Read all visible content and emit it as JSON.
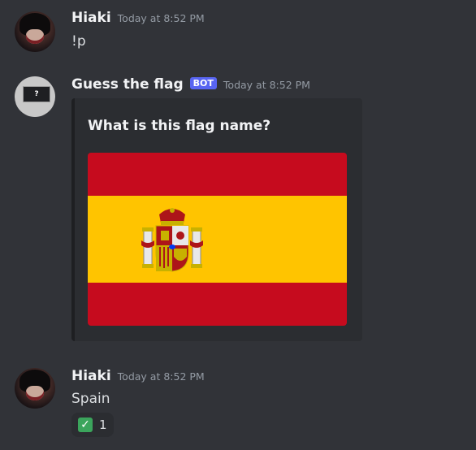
{
  "messages": [
    {
      "username": "Hiaki",
      "timestamp": "Today at 8:52 PM",
      "content": "!p"
    },
    {
      "username": "Guess the flag",
      "badge": "BOT",
      "timestamp": "Today at 8:52 PM",
      "avatar_text": "?",
      "embed": {
        "title": "What is this flag name?",
        "image": "spain-flag"
      }
    },
    {
      "username": "Hiaki",
      "timestamp": "Today at 8:52 PM",
      "content": "Spain",
      "reaction": {
        "emoji": "✅",
        "emoji_icon": "check-mark-icon",
        "count": "1"
      }
    }
  ],
  "colors": {
    "background": "#313338",
    "embed_background": "#2b2d31",
    "bot_badge": "#5865f2",
    "flag_red": "#c60b1e",
    "flag_yellow": "#ffc400",
    "reaction_check": "#3ba55c"
  }
}
